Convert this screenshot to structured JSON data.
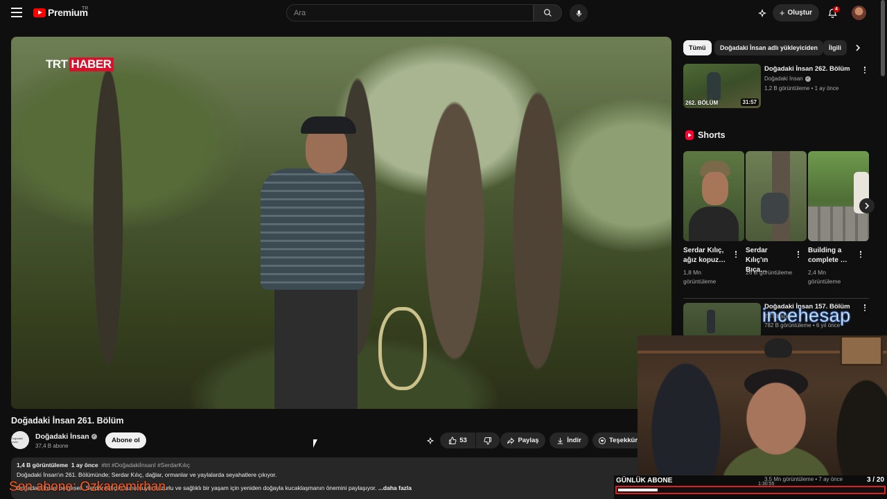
{
  "header": {
    "logo_text": "Premium",
    "logo_region": "TR",
    "search_placeholder": "Ara",
    "create_label": "Oluştur",
    "notifications_count": "4"
  },
  "video": {
    "title": "Doğadaki İnsan 261. Bölüm",
    "overlay_brand_1": "TRT",
    "overlay_brand_2": "HABER"
  },
  "channel": {
    "name": "Doğadaki İnsan",
    "subscribers": "37,4 B abone",
    "subscribe_label": "Abone ol",
    "avatar_text": "Doğadaki İnsan"
  },
  "actions": {
    "likes": "53",
    "share_label": "Paylaş",
    "download_label": "İndir",
    "thanks_label": "Teşekkür"
  },
  "description": {
    "views": "1,4 B görüntüleme",
    "time": "1 ay önce",
    "tags": "#trt #DoğadakiİnsanI #SerdarKılıç",
    "line1": "Doğadaki İnsan'ın 261. Bölümünde; Serdar Kılıç, dağlar, ormanlar ve yaylalarda seyahatlere çıkıyor.",
    "line2": "Doğadaki İnsan belgeseli, Serdar Kılıç'ın sunumuyla huzurlu ve sağlıklı bir yaşam için yeniden doğayla kucaklaşmanın önemini paylaşıyor.",
    "more": "...daha fazla"
  },
  "sidebar": {
    "chips": [
      "Tümü",
      "Doğadaki İnsan adlı yükleyiciden",
      "İlgili"
    ],
    "rec1": {
      "title": "Doğadaki İnsan 262. Bölüm",
      "channel": "Doğadaki İnsan",
      "meta": "1,2 B görüntüleme • 1 ay önce",
      "duration": "31:57",
      "thumb_label": "262. BÖLÜM"
    },
    "shorts_heading": "Shorts",
    "shorts": [
      {
        "title": "Serdar Kılıç, ağız kopuz…",
        "views": "1,8 Mn görüntüleme"
      },
      {
        "title": "Serdar Kılıç'ın Bıça…",
        "views": "26 B görüntüleme"
      },
      {
        "title": "Building a complete …",
        "views": "2,4 Mn görüntüleme"
      }
    ],
    "rec2": {
      "title": "Doğadaki İnsan 157. Bölüm",
      "channel": "TRT Haber",
      "meta": "782 B görüntüleme • 6 yıl önce"
    }
  },
  "stream_overlay": {
    "watermark": "incehesap",
    "goal_label": "GÜNLÜK ABONE",
    "goal_count": "3 / 20",
    "goal_progress": 0.15,
    "timer": "1:30:55",
    "bg_views": "3,5 Mn görüntüleme • 7 ay önce",
    "last_sub": "Son abone: Ozkanemirhan"
  },
  "colors": {
    "bg": "#0f0f0f",
    "youtube_red": "#ff0000",
    "pill_bg": "#272727",
    "goal_border": "#e02020",
    "last_sub": "#ff5a1f"
  }
}
